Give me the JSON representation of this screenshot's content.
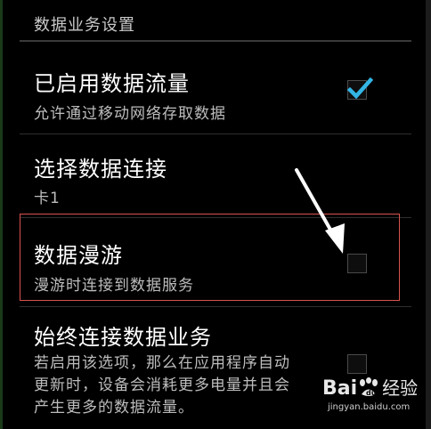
{
  "section": {
    "header": "数据业务设置"
  },
  "items": [
    {
      "title": "已启用数据流量",
      "summary": "允许通过移动网络存取数据",
      "checked": true
    },
    {
      "title": "选择数据连接",
      "summary": "卡1"
    },
    {
      "title": "数据漫游",
      "summary": "漫游时连接到数据服务",
      "checked": false
    },
    {
      "title": "始终连接数据业务",
      "summary": "若启用该选项，那么在应用程序自动更新时，设备会消耗更多电量并且会产生更多的数据流量。",
      "checked": false
    }
  ],
  "watermark": {
    "logo_text": "Bai",
    "logo_text_cn": "经验",
    "url": "jingyan.baidu.com"
  },
  "colors": {
    "background": "#000000",
    "title": "#ffffff",
    "summary": "#bdbdbd",
    "checkmark": "#33b5e5",
    "highlight_border": "#d9534f"
  }
}
